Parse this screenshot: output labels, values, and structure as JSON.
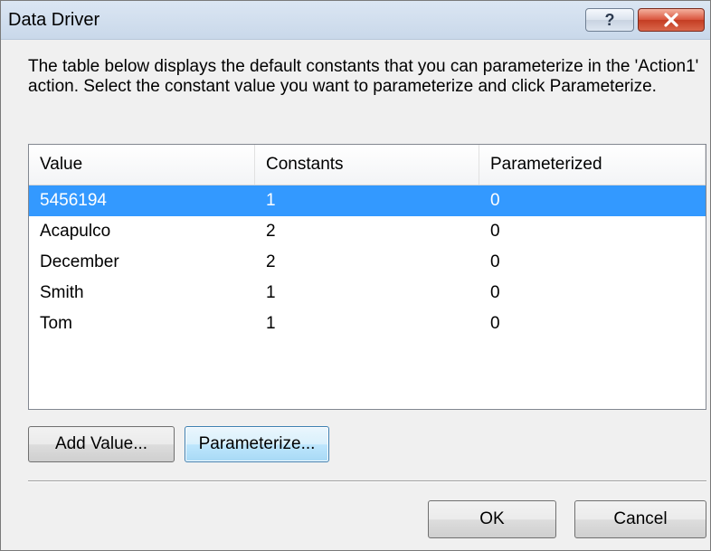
{
  "window": {
    "title": "Data Driver",
    "help_label": "?",
    "close_label": "✕"
  },
  "description": "The table below displays the default constants that you can parameterize in the 'Action1' action. Select the constant value you want to parameterize and click Parameterize.",
  "table": {
    "columns": [
      "Value",
      "Constants",
      "Parameterized"
    ],
    "selected_row": 0,
    "rows": [
      {
        "value": "5456194",
        "constants": "1",
        "parameterized": "0"
      },
      {
        "value": "Acapulco",
        "constants": "2",
        "parameterized": "0"
      },
      {
        "value": "December",
        "constants": "2",
        "parameterized": "0"
      },
      {
        "value": "Smith",
        "constants": "1",
        "parameterized": "0"
      },
      {
        "value": "Tom",
        "constants": "1",
        "parameterized": "0"
      }
    ]
  },
  "buttons": {
    "add_value": "Add Value...",
    "parameterize": "Parameterize...",
    "ok": "OK",
    "cancel": "Cancel"
  },
  "colors": {
    "selection": "#3399ff",
    "close_button": "#c43d23",
    "titlebar": "#c9d8ea"
  },
  "icons": {
    "help": "question-mark-icon",
    "close": "close-icon"
  }
}
